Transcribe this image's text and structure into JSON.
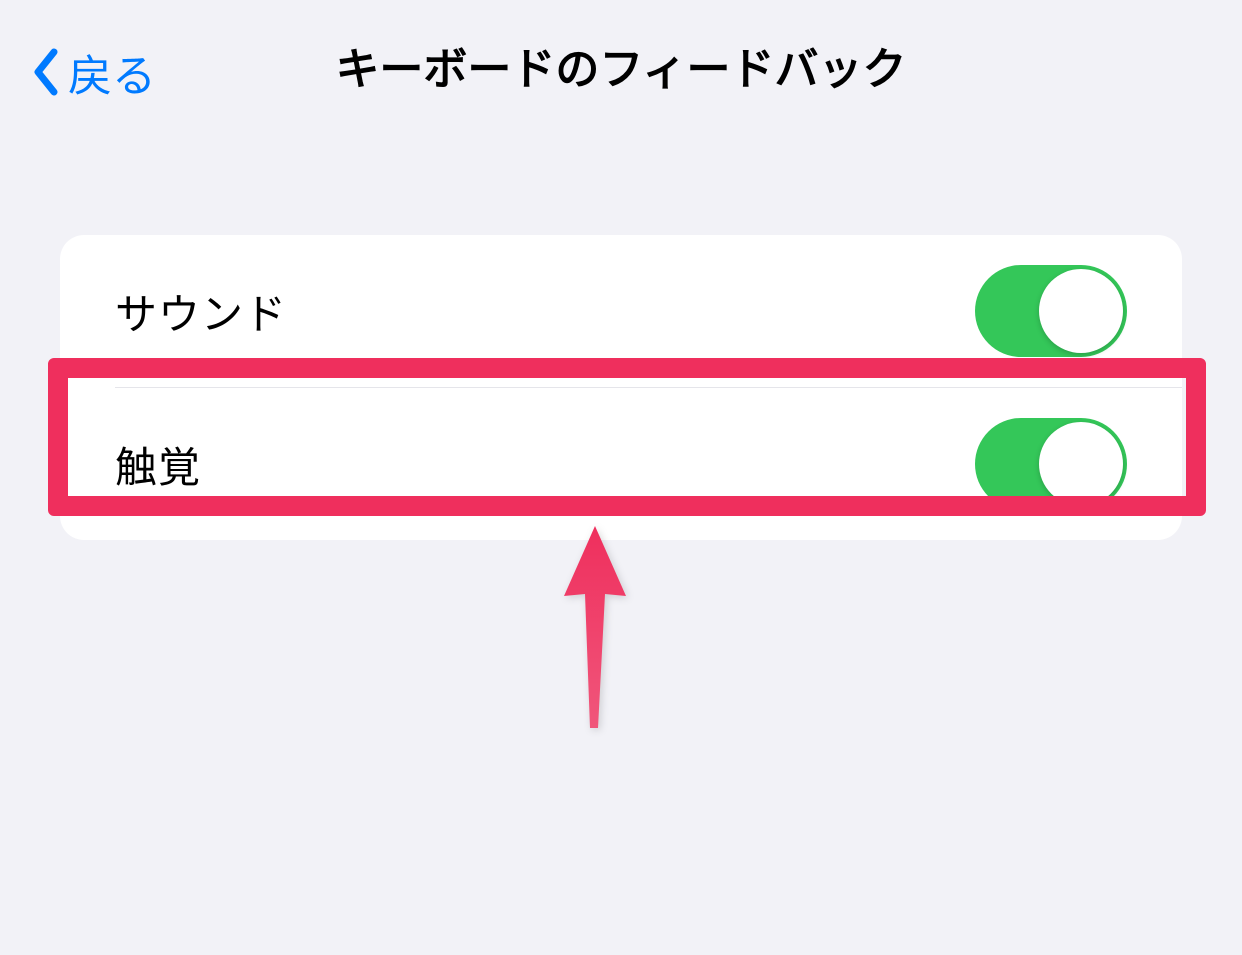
{
  "header": {
    "back_label": "戻る",
    "title": "キーボードのフィードバック"
  },
  "settings": {
    "sound": {
      "label": "サウンド",
      "enabled": true
    },
    "haptic": {
      "label": "触覚",
      "enabled": true
    }
  },
  "colors": {
    "accent": "#007aff",
    "toggle_on": "#34c759",
    "highlight": "#ef2f5d",
    "background": "#f2f2f7"
  },
  "annotation": {
    "highlight_target": "haptic-row",
    "arrow_direction": "up"
  }
}
